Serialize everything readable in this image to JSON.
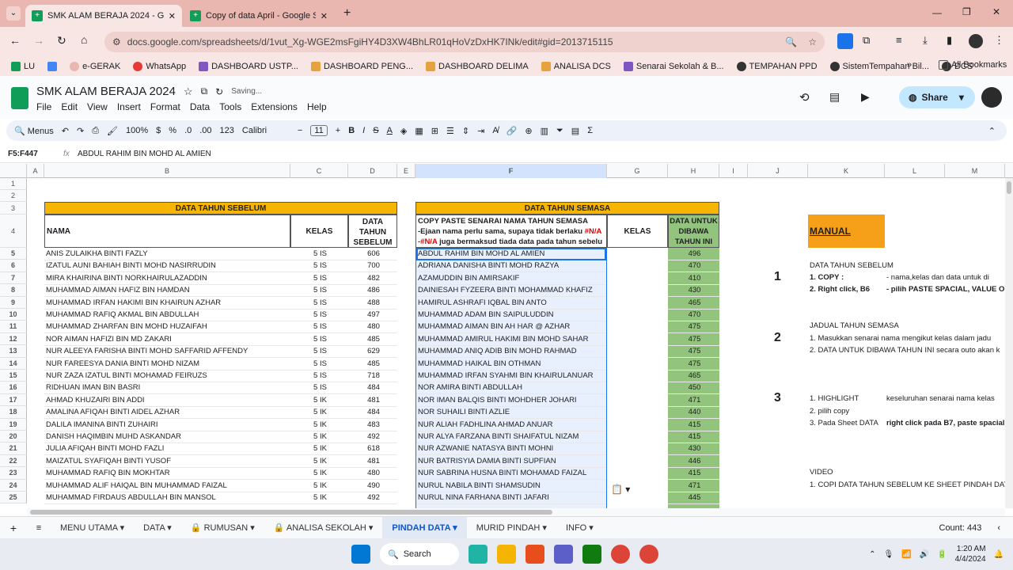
{
  "browser": {
    "tabs": [
      {
        "title": "SMK ALAM BERAJA 2024 - Goo",
        "active": true
      },
      {
        "title": "Copy of data April - Google She",
        "active": false
      }
    ],
    "url": "docs.google.com/spreadsheets/d/1vut_Xg-WGE2msFgiHY4D3XW4BhLR01qHoVzDxHK7INk/edit#gid=2013715115",
    "bookmarks": [
      "LU",
      "e-GERAK",
      "WhatsApp",
      "DASHBOARD USTP...",
      "DASHBOARD PENG...",
      "DASHBOARD DELIMA",
      "ANALISA DCS",
      "Senarai Sekolah & B...",
      "TEMPAHAN PPD",
      "SistemTempahan Bil...",
      "DCS"
    ],
    "all_bookmarks": "All Bookmarks"
  },
  "doc": {
    "title": "SMK ALAM BERAJA 2024",
    "status": "Saving...",
    "menus": [
      "File",
      "Edit",
      "View",
      "Insert",
      "Format",
      "Data",
      "Tools",
      "Extensions",
      "Help"
    ],
    "share": "Share"
  },
  "toolbar": {
    "menus": "Menus",
    "zoom": "100%",
    "currency": "$",
    "percent": "%",
    "dec_less": ".0",
    "dec_more": ".00",
    "format123": "123",
    "font": "Calibri",
    "font_size": "11"
  },
  "formula": {
    "cell_ref": "F5:F447",
    "fx": "fx",
    "content": "ABDUL RAHIM BIN MOHD AL AMIEN"
  },
  "columns": [
    "A",
    "B",
    "C",
    "D",
    "E",
    "F",
    "G",
    "H",
    "I",
    "J",
    "K",
    "L",
    "M"
  ],
  "rows": [
    "1",
    "2",
    "3",
    "4",
    "5",
    "6",
    "7",
    "8",
    "9",
    "10",
    "11",
    "12",
    "13",
    "14",
    "15",
    "16",
    "17",
    "18",
    "19",
    "20",
    "21",
    "22",
    "23",
    "24",
    "25"
  ],
  "left_table": {
    "title": "DATA TAHUN SEBELUM",
    "headers": {
      "nama": "NAMA",
      "kelas": "KELAS",
      "data": "DATA TAHUN SEBELUM"
    },
    "rows": [
      [
        "ANIS ZULAIKHA BINTI FAZLY",
        "5 IS",
        "606"
      ],
      [
        "IZATUL AUNI BAHIAH BINTI MOHD NASIRRUDIN",
        "5 IS",
        "700"
      ],
      [
        "MIRA KHAIRINA BINTI NORKHAIRULAZADDIN",
        "5 IS",
        "482"
      ],
      [
        "MUHAMMAD AIMAN HAFIZ BIN HAMDAN",
        "5 IS",
        "486"
      ],
      [
        "MUHAMMAD IRFAN HAKIMI BIN KHAIRUN AZHAR",
        "5 IS",
        "488"
      ],
      [
        "MUHAMMAD RAFIQ AKMAL BIN ABDULLAH",
        "5 IS",
        "497"
      ],
      [
        "MUHAMMAD ZHARFAN BIN MOHD HUZAIFAH",
        "5 IS",
        "480"
      ],
      [
        "NOR AIMAN HAFIZI BIN MD ZAKARI",
        "5 IS",
        "485"
      ],
      [
        "NUR ALEEYA FARISHA BINTI MOHD SAFFARID AFFENDY",
        "5 IS",
        "629"
      ],
      [
        "NUR FAREESYA DANIA BINTI MOHD NIZAM",
        "5 IS",
        "485"
      ],
      [
        "NUR ZAZA IZATUL BINTI MOHAMAD FEIRUZS",
        "5 IS",
        "718"
      ],
      [
        "RIDHUAN IMAN BIN BASRI",
        "5 IS",
        "484"
      ],
      [
        "AHMAD KHUZAIRI BIN ADDI",
        "5 IK",
        "481"
      ],
      [
        "AMALINA AFIQAH BINTI AIDEL AZHAR",
        "5 IK",
        "484"
      ],
      [
        "DALILA IMANINA BINTI ZUHAIRI",
        "5 IK",
        "483"
      ],
      [
        "DANISH HAQIMBIN MUHD ASKANDAR",
        "5 IK",
        "492"
      ],
      [
        "JULIA AFIQAH BINTI MOHD FAZLI",
        "5 IK",
        "618"
      ],
      [
        "MAIZATUL SYAFIQAH BINTI YUSOF",
        "5 IK",
        "481"
      ],
      [
        "MUHAMMAD RAFIQ BIN MOKHTAR",
        "5 IK",
        "480"
      ],
      [
        "MUHAMMAD ALIF HAIQAL BIN MUHAMMAD FAIZAL",
        "5 IK",
        "490"
      ],
      [
        "MUHAMMAD FIRDAUS ABDULLAH BIN MANSOL",
        "5 IK",
        "492"
      ]
    ]
  },
  "right_table": {
    "title": "DATA TAHUN SEMASA",
    "header_line1": "COPY PASTE SENARAI NAMA TAHUN SEMASA",
    "header_line2a": "-Ejaan nama perlu sama, supaya tidak berlaku ",
    "na1": "#N/A",
    "na2": "-#N/A",
    "header_line3": " juga bermaksud tiada data pada tahun sebelu",
    "kelas": "KELAS",
    "data_header": "DATA UNTUK DIBAWA TAHUN INI",
    "rows": [
      [
        "ABDUL RAHIM BIN MOHD AL AMIEN",
        "496"
      ],
      [
        "ADRIANA DANISHA BINTI MOHD RAZYA",
        "470"
      ],
      [
        "AZAMUDDIN BIN AMIRSAKIF",
        "410"
      ],
      [
        "DAINIESAH FYZEERA BINTI MOHAMMAD KHAFIZ",
        "430"
      ],
      [
        "HAMIRUL ASHRAFI IQBAL BIN ANTO",
        "465"
      ],
      [
        "MUHAMMAD ADAM BIN SAIPULUDDIN",
        "470"
      ],
      [
        "MUHAMMAD AIMAN BIN AH HAR @ AZHAR",
        "475"
      ],
      [
        "MUHAMMAD AMIRUL HAKIMI BIN MOHD SAHAR",
        "475"
      ],
      [
        "MUHAMMAD ANIQ ADIB BIN MOHD RAHMAD",
        "475"
      ],
      [
        "MUHAMMAD HAIKAL BIN OTHMAN",
        "475"
      ],
      [
        "MUHAMMAD IRFAN SYAHMI BIN KHAIRULANUAR",
        "465"
      ],
      [
        "NOR AMIRA BINTI ABDULLAH",
        "450"
      ],
      [
        "NOR IMAN BALQIS BINTI MOHDHER JOHARI",
        "471"
      ],
      [
        "NOR SUHAILI BINTI AZLIE",
        "440"
      ],
      [
        "NUR ALIAH FADHLINA AHMAD ANUAR",
        "415"
      ],
      [
        "NUR ALYA FARZANA BINTI SHAIFATUL NIZAM",
        "415"
      ],
      [
        "NUR AZWANIE NATASYA BINTI MOHNI",
        "430"
      ],
      [
        "NUR BATRISYIA DAMIA BINTI SUPFIAN",
        "446"
      ],
      [
        "NUR SABRINA HUSNA BINTI MOHAMAD FAIZAL",
        "415"
      ],
      [
        "NURUL NABILA BINTI SHAMSUDIN",
        "471"
      ],
      [
        "NURUL NINA FARHANA BINTI JAFARI",
        "445"
      ]
    ]
  },
  "manual": {
    "title": "MANUAL",
    "s1_num": "1",
    "s1_title": "DATA TAHUN SEBELUM",
    "s1_l1a": "1. COPY :",
    "s1_l1b": "- nama,kelas dan data untuk di",
    "s1_l2a": "2. Right click, B6",
    "s1_l2b": "- pilih PASTE SPACIAL, VALUE ON",
    "s2_num": "2",
    "s2_title": "JADUAL TAHUN SEMASA",
    "s2_l1": "1. Masukkan senarai nama mengikut kelas dalam jadu",
    "s2_l2": "2. DATA UNTUK DIBAWA TAHUN INI secara outo akan k",
    "s3_num": "3",
    "s3_l1a": "1. HIGHLIGHT",
    "s3_l1b": "keseluruhan senarai nama kelas",
    "s3_l2": "2. pilih copy",
    "s3_l3a": "3. Pada Sheet DATA",
    "s3_l3b": "right click pada B7, paste spacial,",
    "video_title": "VIDEO",
    "video_l1": "1. COPI DATA TAHUN SEBELUM KE SHEET PINDAH DATA"
  },
  "sheets": [
    {
      "name": "MENU UTAMA",
      "active": false,
      "locked": false
    },
    {
      "name": "DATA",
      "active": false,
      "locked": false
    },
    {
      "name": "RUMUSAN",
      "active": false,
      "locked": true
    },
    {
      "name": "ANALISA SEKOLAH",
      "active": false,
      "locked": true
    },
    {
      "name": "PINDAH DATA",
      "active": true,
      "locked": false
    },
    {
      "name": "MURID PINDAH",
      "active": false,
      "locked": false
    },
    {
      "name": "INFO",
      "active": false,
      "locked": false
    }
  ],
  "count": "Count: 443",
  "taskbar": {
    "search": "Search",
    "time": "1:20 AM",
    "date": "4/4/2024"
  },
  "colors": {
    "yellow_header": "#f6b500",
    "green_col": "#93c47d",
    "manual_orange": "#f6a01a",
    "selection_blue": "#e8f0fe"
  }
}
